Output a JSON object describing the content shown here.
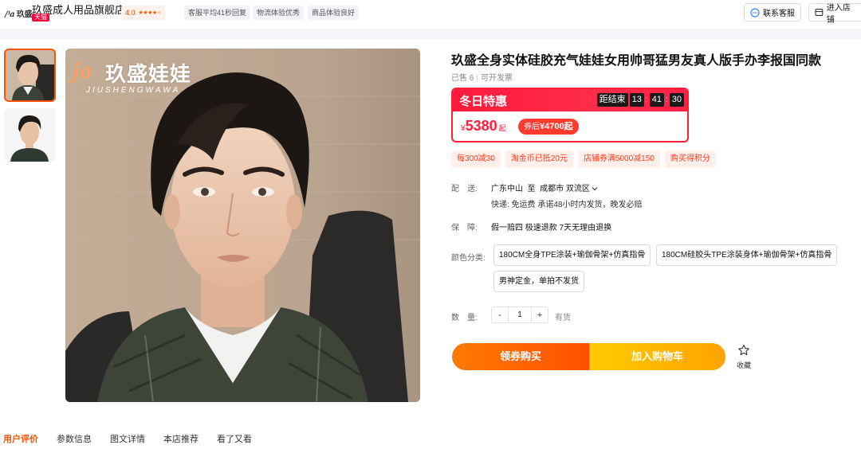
{
  "header": {
    "logo_text": "玖盛",
    "shop_name": "玖盛成人用品旗舰店",
    "tmall_badge": "天猫",
    "rating": "4.0",
    "stars": 4,
    "chips": [
      "客服平均41秒回复",
      "物流体验优秀",
      "商品体验良好"
    ],
    "contact_label": "联系客服",
    "enter_shop_label": "进入店铺"
  },
  "gallery": {
    "watermark_logo": "ja",
    "watermark_cn": "玖盛娃娃",
    "watermark_en": "JIUSHENGWAWA",
    "thumbnails": [
      "thumb-1",
      "thumb-2"
    ],
    "active_index": 0
  },
  "product": {
    "title": "玖盛全身实体硅胶充气娃娃女用帅哥猛男友真人版手办李报国同款",
    "sold": "已售 6",
    "invoice": "可开发票",
    "promo": {
      "title": "冬日特惠",
      "ends_label": "距结束",
      "hours": "13",
      "minutes": "41",
      "seconds": "30",
      "currency": "¥",
      "price": "5380",
      "price_suffix": "起",
      "coupon_prefix": "券后",
      "coupon_price": "¥4700起"
    },
    "tags": [
      "每300减30",
      "淘金币已抵20元",
      "店铺券满5000减150",
      "购买得积分"
    ],
    "shipping": {
      "label": "配　送:",
      "from": "广东中山",
      "to_word": "至",
      "to": "成都市 双流区",
      "detail": "快递: 免运费  承诺48小时内发货，晚发必赔"
    },
    "guarantee": {
      "label": "保　障:",
      "text": "假一赔四 极速退款 7天无理由退换"
    },
    "sku": {
      "label": "颜色分类:",
      "options": [
        "180CM全身TPE涂装+瑜伽骨架+仿真指骨",
        "180CM硅胶头TPE涂装身体+瑜伽骨架+仿真指骨",
        "男神定金，单拍不发货"
      ]
    },
    "quantity": {
      "label": "数　量:",
      "minus": "-",
      "value": "1",
      "plus": "+",
      "stock": "有货"
    },
    "buy_label": "领券购买",
    "cart_label": "加入购物车",
    "favorite_label": "收藏"
  },
  "tabs": [
    "用户评价",
    "参数信息",
    "图文详情",
    "本店推荐",
    "看了又看"
  ],
  "colors": {
    "accent": "#ff5000",
    "promo_red": "#ff1f3b"
  }
}
